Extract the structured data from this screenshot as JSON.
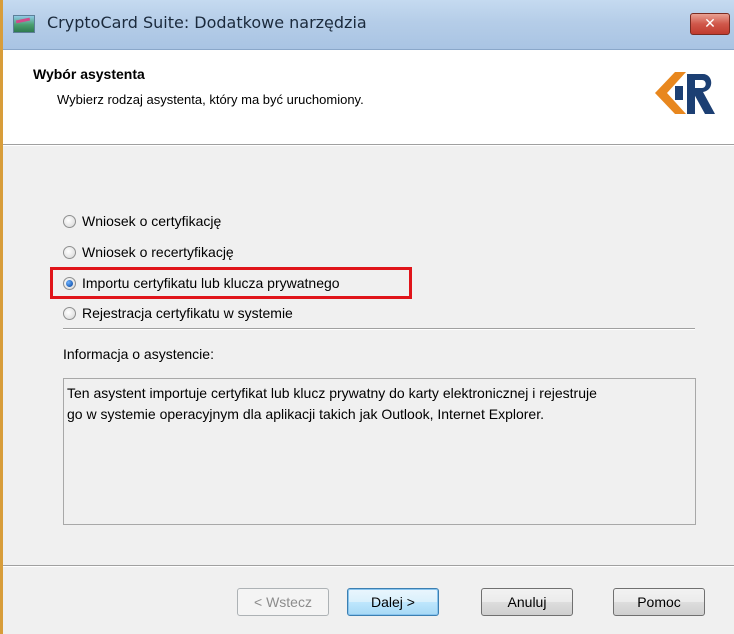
{
  "window": {
    "title": "CryptoCard Suite: Dodatkowe narzędzia",
    "close_symbol": "✕",
    "border_color": "#d89d3a"
  },
  "header": {
    "title": "Wybór asystenta",
    "subtitle": "Wybierz rodzaj asystenta, który ma być uruchomiony.",
    "logo_icon": "kir-logo-icon",
    "logo_color": "#e8871e",
    "logo_dark_color": "#1c3f73"
  },
  "options": [
    {
      "label": "Wniosek o certyfikację",
      "checked": false
    },
    {
      "label": "Wniosek o recertyfikację",
      "checked": false
    },
    {
      "label": "Importu certyfikatu lub klucza prywatnego",
      "checked": true
    },
    {
      "label": "Rejestracja certyfikatu w systemie",
      "checked": false
    }
  ],
  "highlight_color": "#e0141a",
  "info": {
    "label": "Informacja o asystencie:",
    "text_line1": "Ten asystent importuje certyfikat lub klucz prywatny do karty elektronicznej i rejestruje",
    "text_line2": "go w systemie operacyjnym dla aplikacji takich jak Outlook, Internet Explorer."
  },
  "buttons": {
    "back": "< Wstecz",
    "next": "Dalej >",
    "cancel": "Anuluj",
    "help": "Pomoc"
  }
}
